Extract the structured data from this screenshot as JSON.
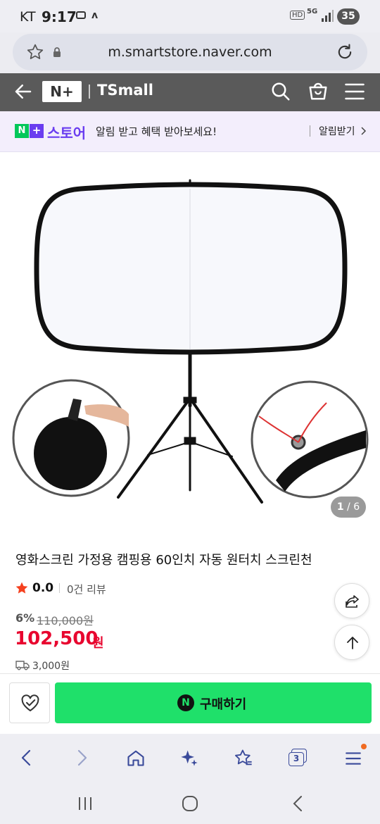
{
  "status": {
    "carrier": "KT",
    "time": "9:17",
    "network": "5G",
    "hd": "HD",
    "battery": "35"
  },
  "browser": {
    "url": "m.smartstore.naver.com",
    "tab_count": "3"
  },
  "store_header": {
    "brand_badge": "N+",
    "store_name": "TSmall"
  },
  "promo": {
    "logo_text": "스토어",
    "message": "알림 받고 혜택 받아보세요!",
    "action": "알림받기",
    "badge_color": "#03c75a",
    "logo_color": "#6a3df0"
  },
  "gallery": {
    "current": "1",
    "separator": " / ",
    "total": "6"
  },
  "product": {
    "title": "영화스크린 가정용 캠핑용 60인치 자동 원터치 스크린천",
    "rating": "0.0",
    "review_count": "0건 리뷰",
    "discount": "6%",
    "original_price": "110,000원",
    "price": "102,500",
    "price_unit": "원",
    "shipping": "3,000원",
    "price_color": "#e8062f",
    "star_color": "#f5401e"
  },
  "buy": {
    "label": "구매하기",
    "color": "#1fe06a"
  },
  "navigation": {
    "back": "뒤로",
    "home": "홈"
  }
}
